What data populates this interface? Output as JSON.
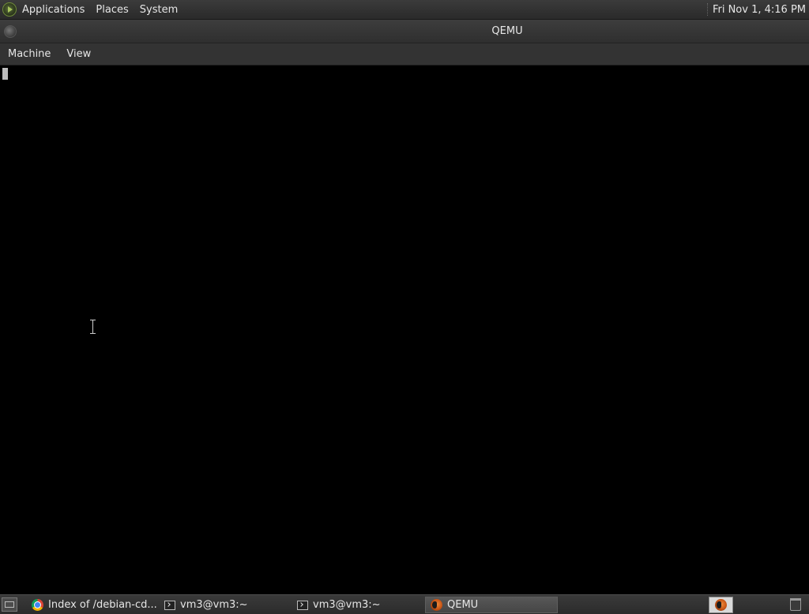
{
  "top_panel": {
    "menus": [
      "Applications",
      "Places",
      "System"
    ],
    "clock": "Fri Nov  1,  4:16 PM"
  },
  "window": {
    "title": "QEMU",
    "menubar": [
      "Machine",
      "View"
    ]
  },
  "taskbar": {
    "tasks": [
      {
        "label": "Index of /debian-cd...",
        "icon": "chrome-icon"
      },
      {
        "label": "vm3@vm3:~",
        "icon": "terminal-icon"
      },
      {
        "label": "vm3@vm3:~",
        "icon": "terminal-icon"
      },
      {
        "label": "QEMU",
        "icon": "qemu-icon",
        "active": true
      }
    ],
    "tray_icons": [
      "qemu-icon",
      "trash-icon"
    ]
  },
  "colors": {
    "panel_bg": "#2f2f2f",
    "display_bg": "#000000",
    "text": "#e6e6e6"
  }
}
